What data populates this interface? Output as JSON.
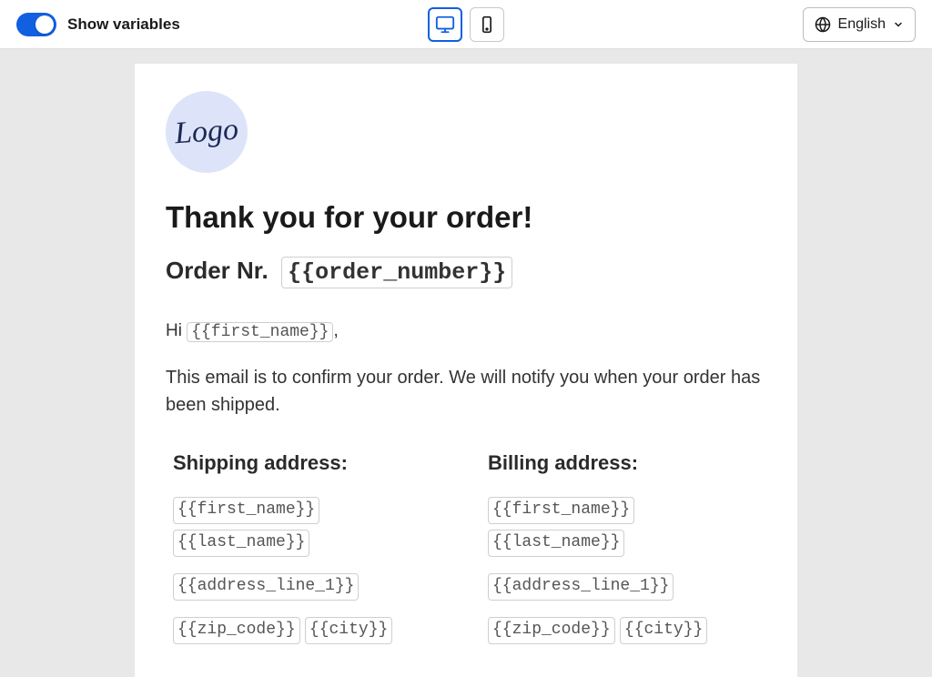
{
  "toolbar": {
    "toggle_label": "Show variables",
    "toggle_on": true,
    "language_label": "English"
  },
  "email": {
    "logo_text": "Logo",
    "heading": "Thank you for your order!",
    "order_label": "Order Nr.",
    "order_var": "{{order_number}}",
    "greeting_prefix": "Hi",
    "greeting_var": "{{first_name}}",
    "greeting_suffix": ",",
    "confirm_text": "This email is to confirm your order. We will notify you when your order has been shipped.",
    "shipping": {
      "heading": "Shipping address:",
      "first_name": "{{first_name}}",
      "last_name": "{{last_name}}",
      "address_line_1": "{{address_line_1}}",
      "zip_code": "{{zip_code}}",
      "city": "{{city}}"
    },
    "billing": {
      "heading": "Billing address:",
      "first_name": "{{first_name}}",
      "last_name": "{{last_name}}",
      "address_line_1": "{{address_line_1}}",
      "zip_code": "{{zip_code}}",
      "city": "{{city}}"
    }
  }
}
